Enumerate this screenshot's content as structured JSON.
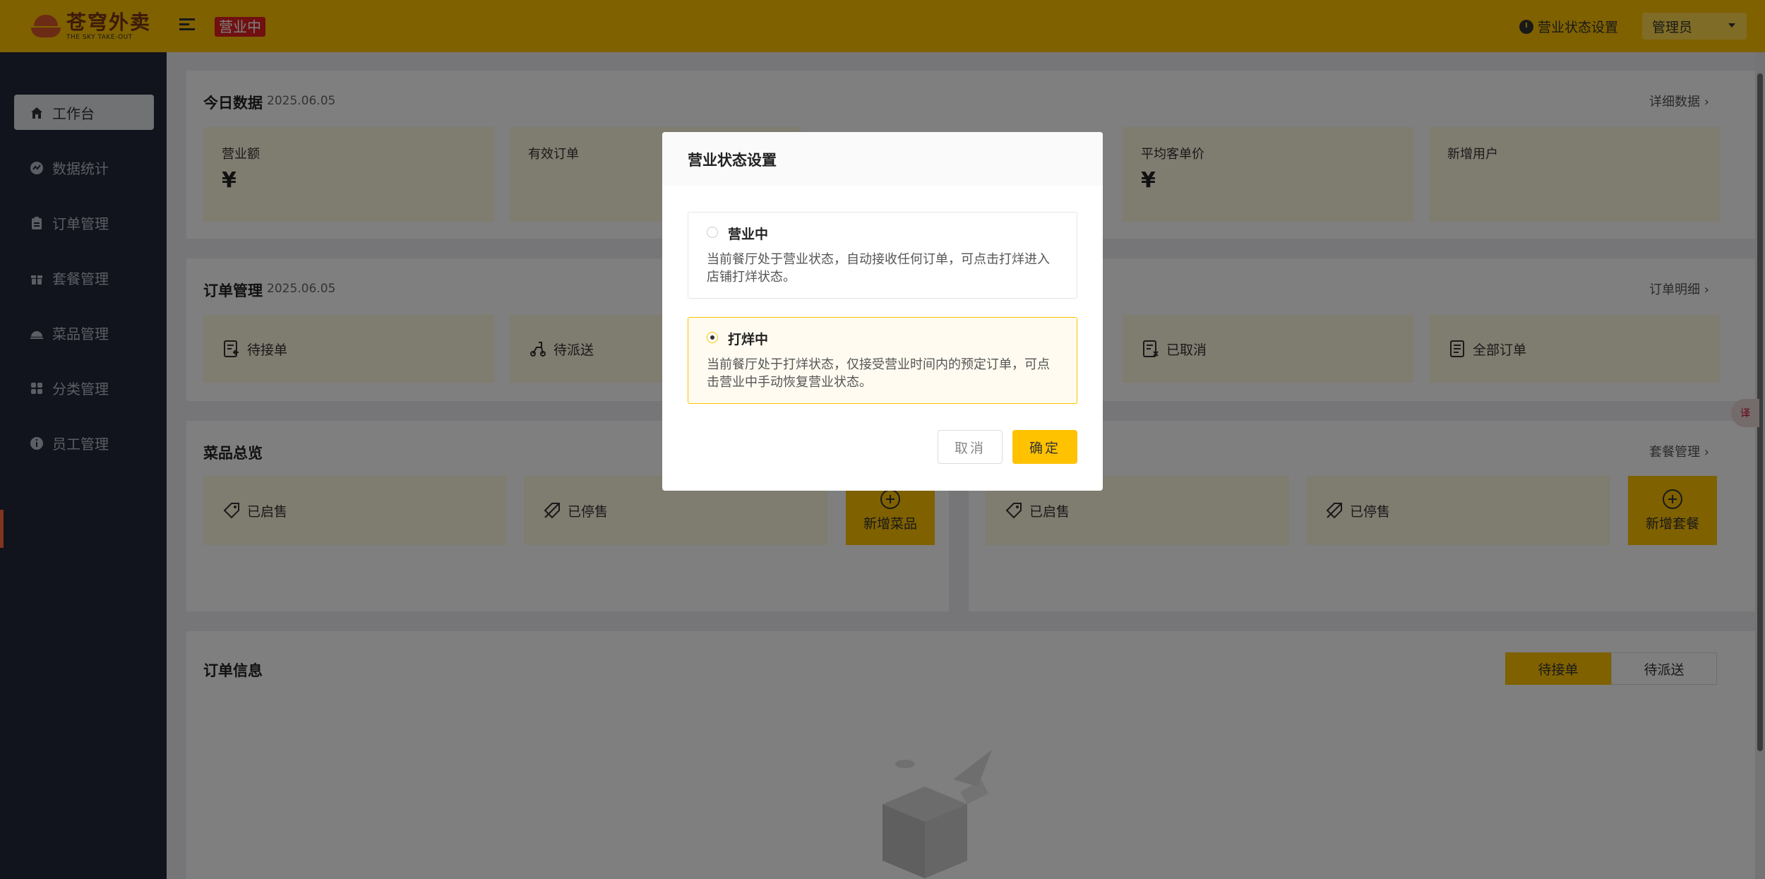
{
  "header": {
    "logo_cn": "苍穹外卖",
    "logo_en": "THE SKY TAKE-OUT",
    "status_tag": "营业中",
    "business_setting": "营业状态设置",
    "admin": "管理员"
  },
  "sidebar": {
    "items": [
      {
        "label": "工作台",
        "icon": "home-icon"
      },
      {
        "label": "数据统计",
        "icon": "chart-icon"
      },
      {
        "label": "订单管理",
        "icon": "clipboard-icon"
      },
      {
        "label": "套餐管理",
        "icon": "gift-icon"
      },
      {
        "label": "菜品管理",
        "icon": "dish-icon"
      },
      {
        "label": "分类管理",
        "icon": "grid-icon"
      },
      {
        "label": "员工管理",
        "icon": "info-icon"
      }
    ]
  },
  "today": {
    "title": "今日数据",
    "date": "2025.06.05",
    "link": "详细数据",
    "cards": [
      {
        "label": "营业额",
        "value": "¥"
      },
      {
        "label": "有效订单",
        "value": ""
      },
      {
        "label": "平均客单价",
        "value": "¥"
      },
      {
        "label": "新增用户",
        "value": ""
      }
    ]
  },
  "orders": {
    "title": "订单管理",
    "date": "2025.06.05",
    "link": "订单明细",
    "cards": [
      {
        "label": "待接单"
      },
      {
        "label": "待派送"
      },
      {
        "label": "已取消"
      },
      {
        "label": "全部订单"
      }
    ]
  },
  "dishes": {
    "title": "菜品总览",
    "on_sale": "已启售",
    "off_sale": "已停售",
    "add": "新增菜品",
    "link": "套餐管理",
    "set_on_sale": "已启售",
    "set_off_sale": "已停售",
    "set_add": "新增套餐"
  },
  "order_info": {
    "title": "订单信息",
    "tabs": [
      "待接单",
      "待派送"
    ]
  },
  "dialog": {
    "title": "营业状态设置",
    "options": [
      {
        "label": "营业中",
        "desc": "当前餐厅处于营业状态，自动接收任何订单，可点击打烊进入店铺打烊状态。",
        "selected": false
      },
      {
        "label": "打烊中",
        "desc": "当前餐厅处于打烊状态，仅接受营业时间内的预定订单，可点击营业中手动恢复营业状态。",
        "selected": true
      }
    ],
    "cancel": "取消",
    "confirm": "确定"
  },
  "colors": {
    "brand": "#ffc200",
    "sidebar": "#22273a",
    "tag": "#e02020"
  }
}
